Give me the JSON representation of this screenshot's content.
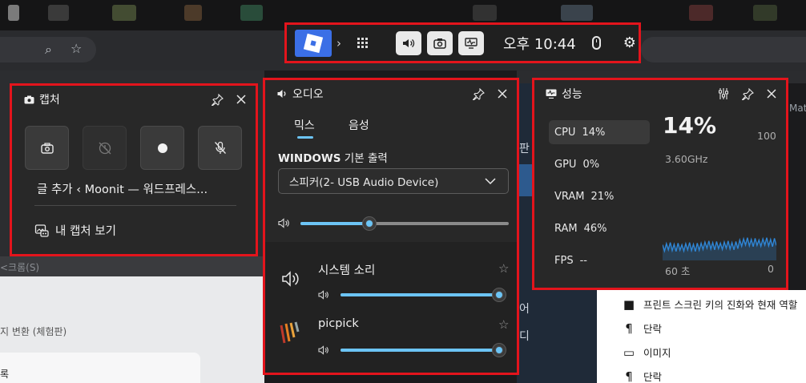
{
  "toolbar": {
    "time": "오후 10:44"
  },
  "capture": {
    "title": "캡처",
    "recent_title": "글 추가 ‹ Moonit — 워드프레스...",
    "view_link": "내 캡처 보기"
  },
  "audio": {
    "title": "오디오",
    "tabs": [
      "믹스",
      "음성"
    ],
    "output_label_bold": "WINDOWS",
    "output_label_rest": " 기본 출력",
    "device": "스피커(2- USB Audio Device)",
    "master_volume": 0.33,
    "apps": [
      {
        "name": "시스템 소리",
        "volume": 1.0
      },
      {
        "name": "picpick",
        "volume": 1.0
      }
    ]
  },
  "performance": {
    "title": "성능",
    "metrics": [
      {
        "label": "CPU",
        "value": "14%"
      },
      {
        "label": "GPU",
        "value": "0%"
      },
      {
        "label": "VRAM",
        "value": "21%"
      },
      {
        "label": "RAM",
        "value": "46%"
      },
      {
        "label": "FPS",
        "value": "--"
      }
    ],
    "big_value": "14%",
    "max_value": "100",
    "clock": "3.60GHz",
    "graph_left": "60 초",
    "graph_right": "0",
    "graph_color": "#2f86d6"
  },
  "background": {
    "left_text_1": "<크롬(S)",
    "left_text_2": "지 변환 (체험판)",
    "left_text_3": "록",
    "mid_text_1": "판",
    "mid_text_2": "어",
    "mid_text_3": "디",
    "right_top": "Math",
    "outline_items": [
      {
        "icon": "bookmark-icon",
        "glyph": "■",
        "text": "프린트 스크린 키의 진화와 현재 역할"
      },
      {
        "icon": "paragraph-icon",
        "glyph": "¶",
        "text": "단락"
      },
      {
        "icon": "image-icon",
        "glyph": "▭",
        "text": "이미지"
      },
      {
        "icon": "paragraph-icon",
        "glyph": "¶",
        "text": "단락"
      }
    ]
  }
}
